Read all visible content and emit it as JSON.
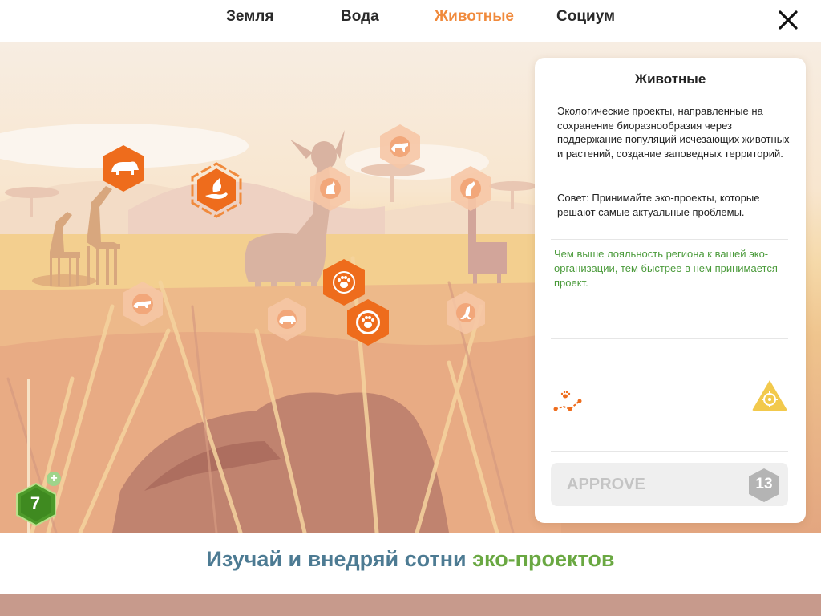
{
  "nav": {
    "tabs": [
      {
        "label": "Земля",
        "active": false
      },
      {
        "label": "Вода",
        "active": false
      },
      {
        "label": "Животные",
        "active": true
      },
      {
        "label": "Социум",
        "active": false
      }
    ],
    "close_icon": "close-icon"
  },
  "colors": {
    "accent_orange": "#f08a3c",
    "hex_active": "#ee6c1c",
    "hex_inactive": "#f6b98d",
    "loyalty_green": "#4a9a3a",
    "banner_blue": "#4d7b93",
    "banner_green": "#6aa842",
    "level_green": "#4d9a2a",
    "warning_yellow": "#f2c94c"
  },
  "scene": {
    "projects": [
      {
        "icon": "rhino-icon",
        "state": "active"
      },
      {
        "icon": "bird-in-hand-icon",
        "state": "active-ringed"
      },
      {
        "icon": "paw-icon",
        "state": "active"
      },
      {
        "icon": "paw-ring-icon",
        "state": "active"
      },
      {
        "icon": "deer-icon",
        "state": "inactive"
      },
      {
        "icon": "leopard-icon",
        "state": "inactive"
      },
      {
        "icon": "giraffe-icon",
        "state": "inactive"
      },
      {
        "icon": "cheetah-icon",
        "state": "inactive"
      },
      {
        "icon": "rhino-icon",
        "state": "inactive"
      },
      {
        "icon": "kangaroo-icon",
        "state": "inactive"
      }
    ],
    "level": "7"
  },
  "panel": {
    "title": "Животные",
    "description": "Экологические проекты, направленные на сохранение биоразнообразия через поддержание популяций исчезающих животных и растений, создание заповедных территорий.",
    "tip": "Совет: Принимайте эко-проекты, которые решают самые актуальные проблемы.",
    "loyalty": "Чем выше лояльность региона к вашей эко-организации, тем быстрее в нем принимается проект.",
    "approve_label": "APPROVE",
    "approve_cost": "13"
  },
  "banner": {
    "text_part1": "Изучай и внедряй сотни",
    "text_part2": "эко-проектов"
  }
}
